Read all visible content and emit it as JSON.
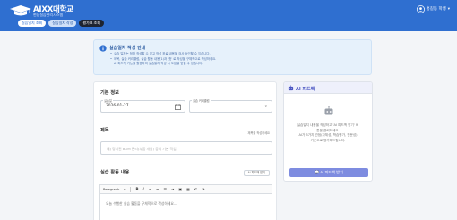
{
  "header": {
    "title": "AIXX대학교",
    "subtitle": "현장실습관리시스템",
    "user_name": "홍길동 학생",
    "chevron": "▾"
  },
  "nav": {
    "items": [
      {
        "label": "실습일지 조회"
      },
      {
        "label": "실습일지 작성"
      },
      {
        "label": "평가표 조회"
      }
    ]
  },
  "notice": {
    "title": "실습일지 작성 안내",
    "items": [
      "실습 일지는 정해 작성할 수 있고 작성 완료 내용을 검사 승인할 수 있습니다.",
      "제목, 실습 커리큘럼, 실습 활동 내용(1)과 '첫' 로 작성을 구체적으로 작성하세요.",
      "AI 피드백 기능을 활용하여 실습일지 작성 시 도움을 받을 수 있습니다."
    ]
  },
  "form": {
    "basic_title": "기본 정보",
    "date_label": "실습일",
    "date_value": "2026-01-27",
    "curriculum_label": "실습 커리큘럼",
    "title_section": "제목",
    "title_hint": "제목을 작성하세요",
    "title_placeholder": "예) 정리된 BOM 관리(부품 개발) 등의 기본 작업",
    "activity_section": "실습 활동 내용",
    "activity_button": "AI 피드백 받기",
    "toolbar_format": "Paragraph",
    "editor_placeholder": "오늘 수행한 실습 활동을 구체적으로 작성하세요..."
  },
  "ai": {
    "title": "AI 피드백",
    "desc": [
      "실습일지 내용을 작성하고 'AI 피드백 받기' 버",
      "튼을 클릭하세요.",
      "AI가 3가지 관점(자체성, 학습평가, 전문성)",
      "기준으로 평가해드립니다."
    ],
    "button_label": "AI 피드백 받기"
  },
  "colors": {
    "header_bg": "#2f6fd0",
    "accent": "#7e8ce0"
  }
}
